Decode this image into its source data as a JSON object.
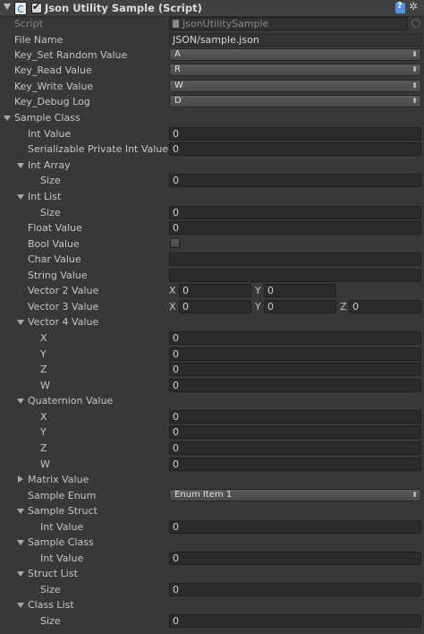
{
  "header": {
    "title": "Json Utility Sample (Script)"
  },
  "script": {
    "label": "Script",
    "value": "JsonUtilitySample"
  },
  "file_name": {
    "label": "File Name",
    "value": "JSON/sample.json"
  },
  "key_set_random": {
    "label": "Key_Set Random Value",
    "value": "A"
  },
  "key_read": {
    "label": "Key_Read Value",
    "value": "R"
  },
  "key_write": {
    "label": "Key_Write Value",
    "value": "W"
  },
  "key_debug": {
    "label": "Key_Debug Log",
    "value": "D"
  },
  "sample_class": {
    "label": "Sample Class",
    "int_value": {
      "label": "Int Value",
      "value": "0"
    },
    "serializable_private": {
      "label": "Serializable Private Int Value",
      "value": "0"
    },
    "int_array": {
      "label": "Int Array",
      "size_label": "Size",
      "size": "0"
    },
    "int_list": {
      "label": "Int List",
      "size_label": "Size",
      "size": "0"
    },
    "float_value": {
      "label": "Float Value",
      "value": "0"
    },
    "bool_value": {
      "label": "Bool Value",
      "checked": false
    },
    "char_value": {
      "label": "Char Value",
      "value": ""
    },
    "string_value": {
      "label": "String Value",
      "value": ""
    },
    "vector2": {
      "label": "Vector 2 Value",
      "x_label": "X",
      "x": "0",
      "y_label": "Y",
      "y": "0"
    },
    "vector3": {
      "label": "Vector 3 Value",
      "x_label": "X",
      "x": "0",
      "y_label": "Y",
      "y": "0",
      "z_label": "Z",
      "z": "0"
    },
    "vector4": {
      "label": "Vector 4 Value",
      "x_label": "X",
      "x": "0",
      "y_label": "Y",
      "y": "0",
      "z_label": "Z",
      "z": "0",
      "w_label": "W",
      "w": "0"
    },
    "quaternion": {
      "label": "Quaternion Value",
      "x_label": "X",
      "x": "0",
      "y_label": "Y",
      "y": "0",
      "z_label": "Z",
      "z": "0",
      "w_label": "W",
      "w": "0"
    },
    "matrix": {
      "label": "Matrix Value"
    },
    "sample_enum": {
      "label": "Sample Enum",
      "value": "Enum Item 1"
    },
    "sample_struct": {
      "label": "Sample Struct",
      "int_label": "Int Value",
      "int_value": "0"
    },
    "nested_class": {
      "label": "Sample Class",
      "int_label": "Int Value",
      "int_value": "0"
    },
    "struct_list": {
      "label": "Struct List",
      "size_label": "Size",
      "size": "0"
    },
    "class_list": {
      "label": "Class List",
      "size_label": "Size",
      "size": "0"
    }
  }
}
